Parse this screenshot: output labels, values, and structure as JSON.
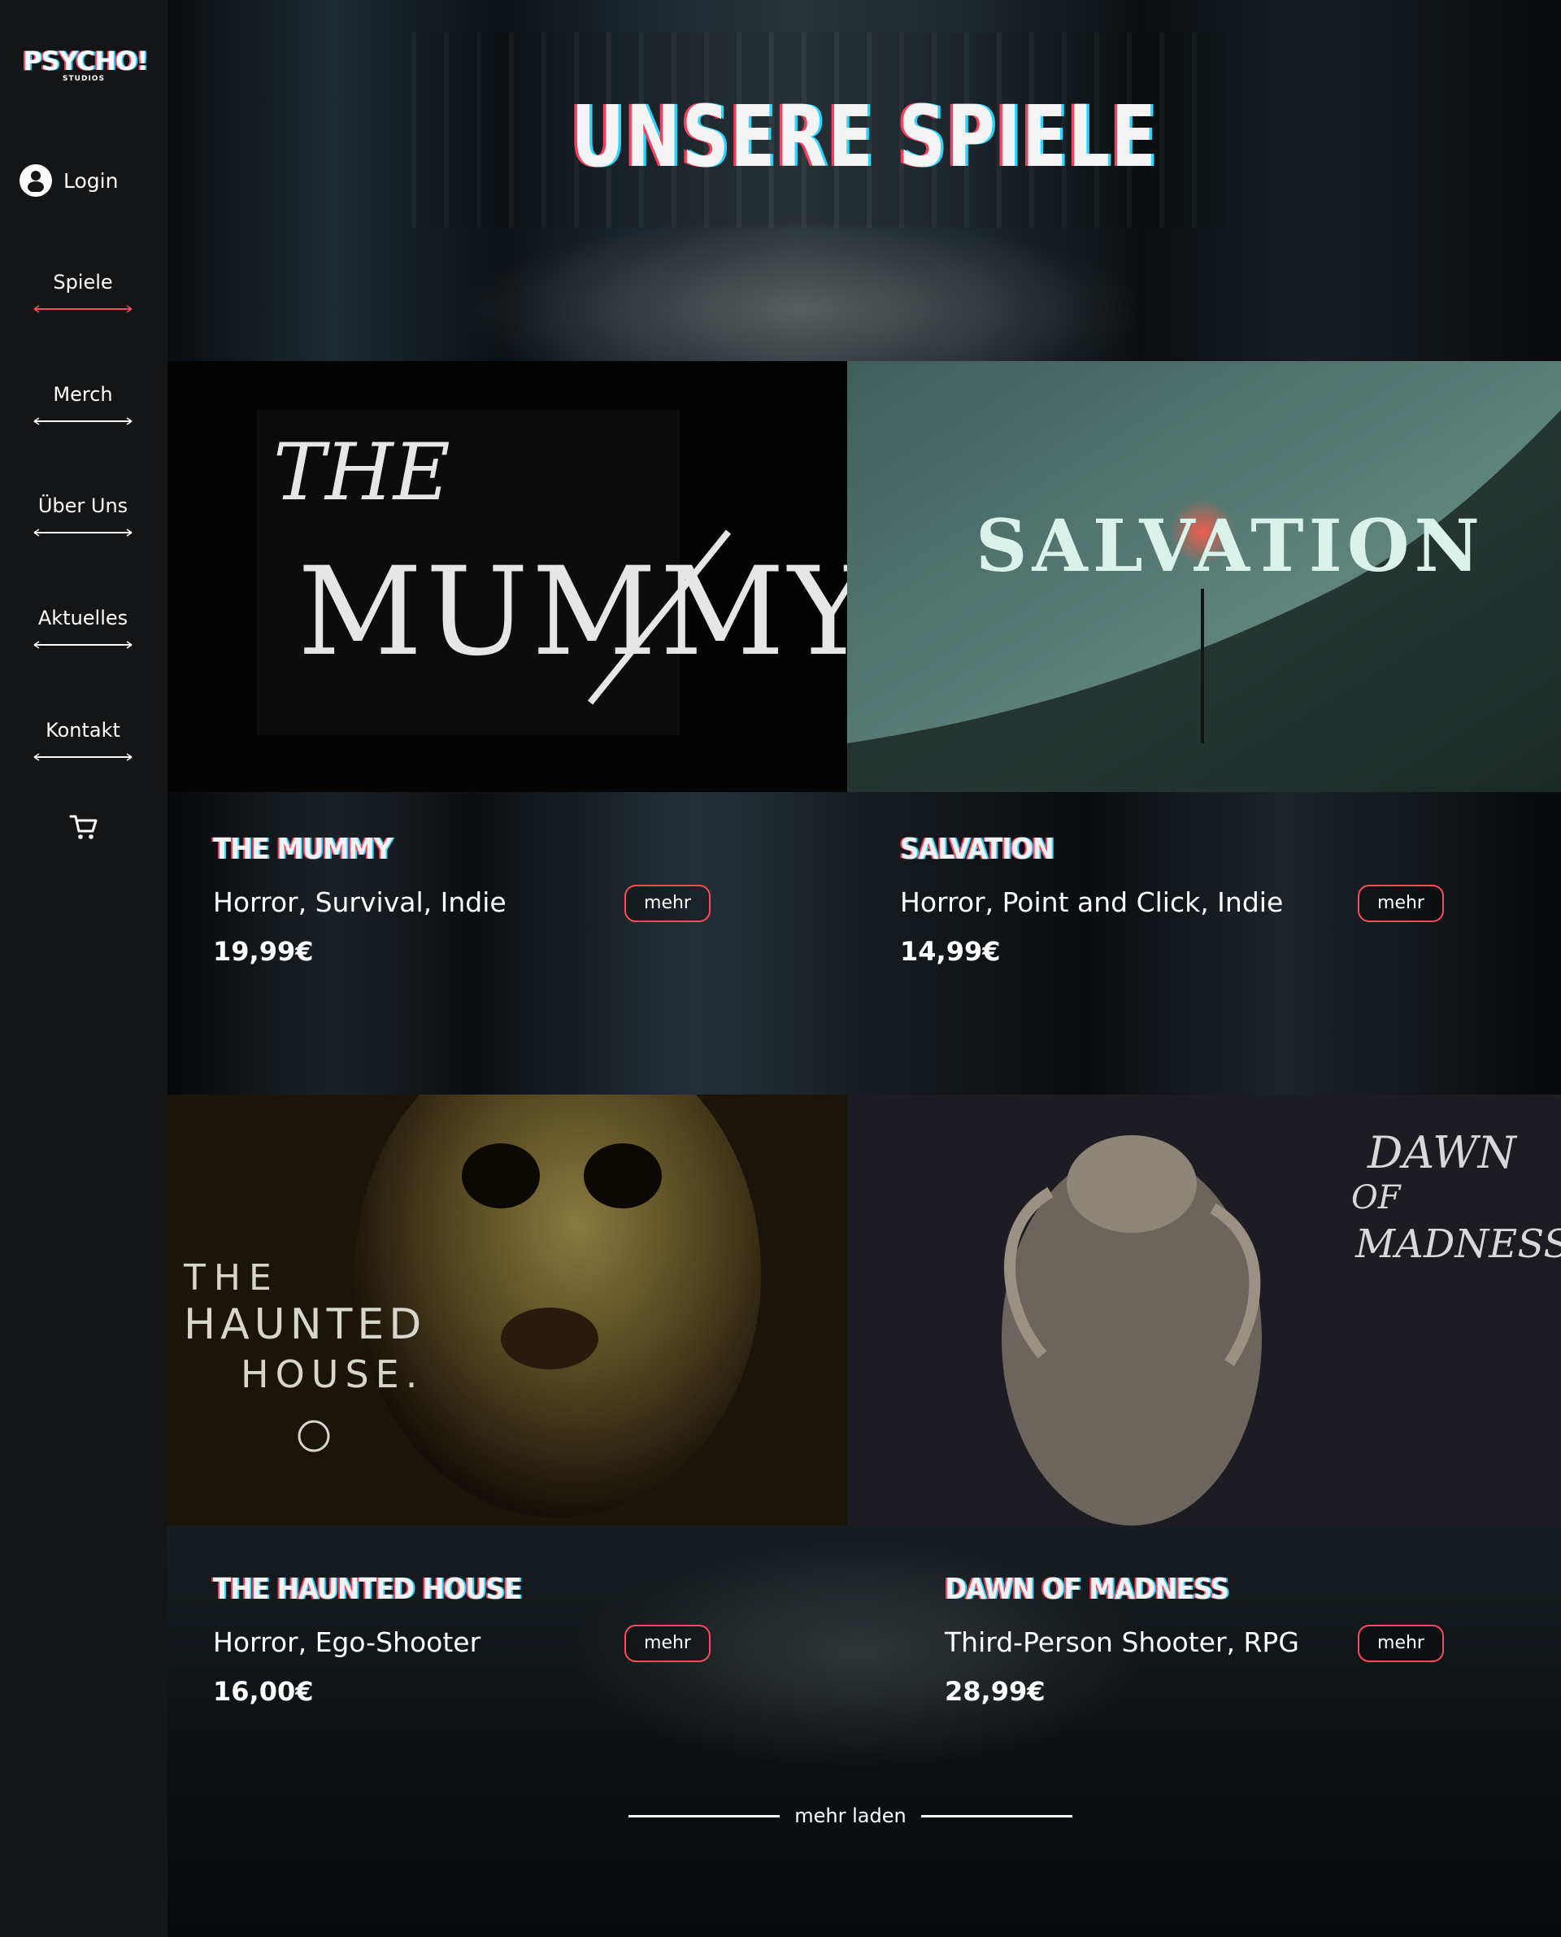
{
  "brand": {
    "name": "PSYCHO!",
    "sub": "STUDIOS"
  },
  "sidebar": {
    "login_label": "Login",
    "nav": [
      {
        "label": "Spiele",
        "active": true
      },
      {
        "label": "Merch",
        "active": false
      },
      {
        "label": "Über Uns",
        "active": false
      },
      {
        "label": "Aktuelles",
        "active": false
      },
      {
        "label": "Kontakt",
        "active": false
      }
    ],
    "cart_icon": "cart-icon"
  },
  "page": {
    "title": "UNSERE SPIELE"
  },
  "games": [
    {
      "title": "THE MUMMY",
      "genre": "Horror, Survival, Indie",
      "price": "19,99€",
      "more_label": "mehr",
      "art_text": [
        "THE",
        "MUMMY"
      ]
    },
    {
      "title": "SALVATION",
      "genre": "Horror, Point and Click, Indie",
      "price": "14,99€",
      "more_label": "mehr",
      "art_text": [
        "SALVATION"
      ]
    },
    {
      "title": "THE HAUNTED HOUSE",
      "genre": "Horror, Ego-Shooter",
      "price": "16,00€",
      "more_label": "mehr",
      "art_text": [
        "THE",
        "HAUNTED",
        "HOUSE."
      ]
    },
    {
      "title": "DAWN OF MADNESS",
      "genre": "Third-Person Shooter, RPG",
      "price": "28,99€",
      "more_label": "mehr",
      "art_text": [
        "DAWN",
        "OF",
        "MADNESS"
      ]
    }
  ],
  "load_more_label": "mehr laden",
  "colors": {
    "accent_red": "#ff4a5b",
    "accent_cyan": "#27d8ff",
    "sidebar_bg": "#141516"
  }
}
